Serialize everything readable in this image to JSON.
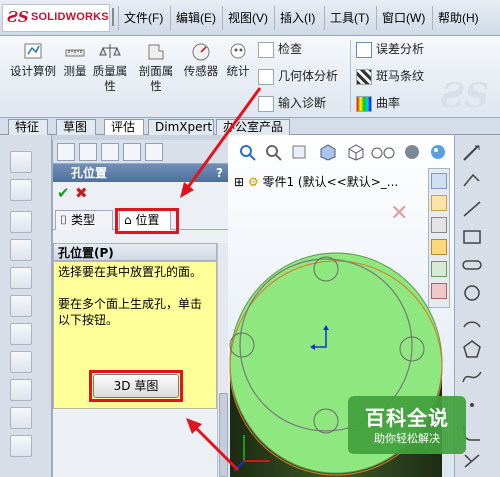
{
  "app": {
    "logo_text": "SOLIDWORKS",
    "menus": [
      "文件(F)",
      "编辑(E)",
      "视图(V)",
      "插入(I)",
      "工具(T)",
      "窗口(W)",
      "帮助(H)"
    ]
  },
  "ribbon": {
    "tools": [
      {
        "label": "设计算例",
        "icon": "design-study-icon"
      },
      {
        "label": "测量",
        "icon": "measure-icon"
      },
      {
        "label": "质量属性",
        "icon": "mass-properties-icon"
      },
      {
        "label": "剖面属性",
        "icon": "section-properties-icon"
      },
      {
        "label": "传感器",
        "icon": "sensor-icon"
      },
      {
        "label": "统计",
        "icon": "statistics-icon"
      }
    ],
    "small_tools": [
      "检查",
      "几何体分析",
      "输入诊断",
      "误差分析",
      "斑马条纹",
      "曲率"
    ]
  },
  "tabs": [
    "特征",
    "草图",
    "评估",
    "DimXpert",
    "办公室产品"
  ],
  "active_tab": "评估",
  "property_manager": {
    "title": "孔位置",
    "help": "?",
    "ok": "✔",
    "cancel": "✖",
    "subtabs": {
      "type": "类型",
      "position": "位置"
    },
    "group_title": "孔位置(P)",
    "text1": "选择要在其中放置孔的面。",
    "text2": "要在多个面上生成孔，单击以下按钮。",
    "button_3d": "3D 草图"
  },
  "graphics": {
    "tree_item": "零件1  (默认<<默认>_..."
  },
  "watermark": {
    "title": "百科全说",
    "subtitle": "助你轻松解决"
  },
  "colors": {
    "highlight": "#e0141e",
    "face_green": "#8ee77f",
    "panel_yellow": "#ffff99"
  }
}
